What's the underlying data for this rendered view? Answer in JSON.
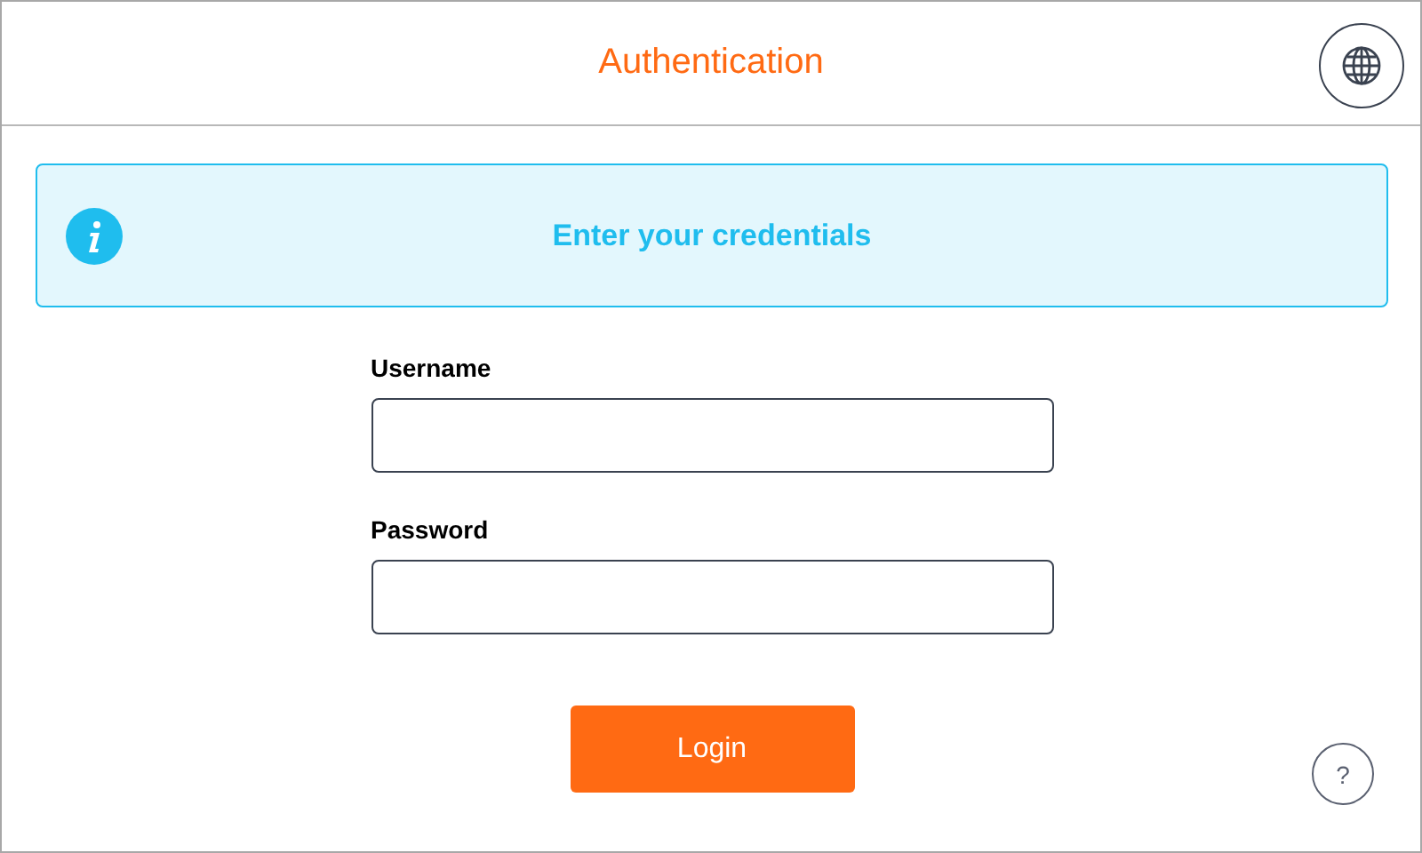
{
  "header": {
    "title": "Authentication"
  },
  "info": {
    "message": "Enter your credentials"
  },
  "fields": [
    {
      "label": "Username"
    },
    {
      "label": "Password"
    }
  ],
  "login_button": "Login",
  "help_button": "?"
}
